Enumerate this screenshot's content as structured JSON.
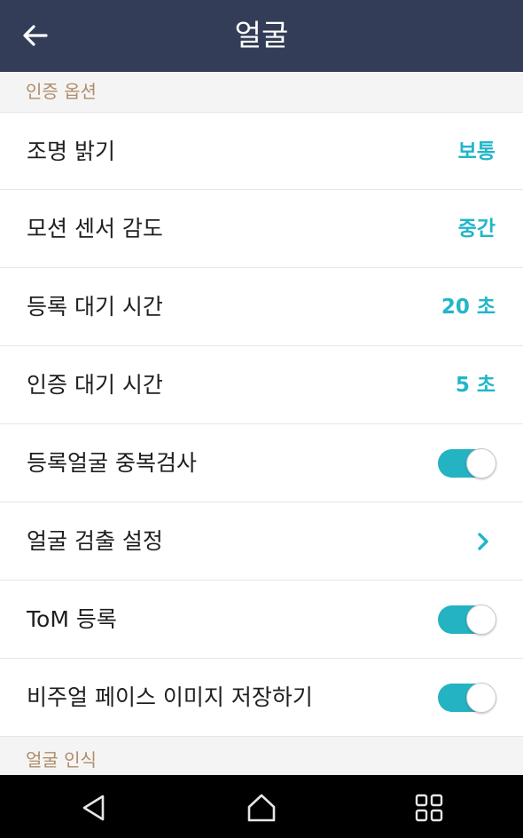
{
  "header": {
    "title": "얼굴",
    "back_icon": "arrow-left-icon"
  },
  "sections": {
    "auth_options": "인증 옵션",
    "face_recognition": "얼굴 인식"
  },
  "settings": [
    {
      "label": "조명 밝기",
      "type": "value",
      "value": "보통"
    },
    {
      "label": "모션 센서 감도",
      "type": "value",
      "value": "중간"
    },
    {
      "label": "등록 대기 시간",
      "type": "value",
      "value": "20 초"
    },
    {
      "label": "인증 대기 시간",
      "type": "value",
      "value": "5 초"
    },
    {
      "label": "등록얼굴 중복검사",
      "type": "toggle",
      "on": true
    },
    {
      "label": "얼굴 검출 설정",
      "type": "link",
      "icon": "chevron-right-icon"
    },
    {
      "label": "ToM 등록",
      "type": "toggle",
      "on": true
    },
    {
      "label": "비주얼 페이스 이미지 저장하기",
      "type": "toggle",
      "on": true
    }
  ],
  "navbar": {
    "back": "nav-back-icon",
    "home": "nav-home-icon",
    "recents": "nav-recents-icon"
  },
  "colors": {
    "header_bg": "#333d57",
    "accent": "#21b6c8",
    "section_text": "#b08c6a"
  }
}
